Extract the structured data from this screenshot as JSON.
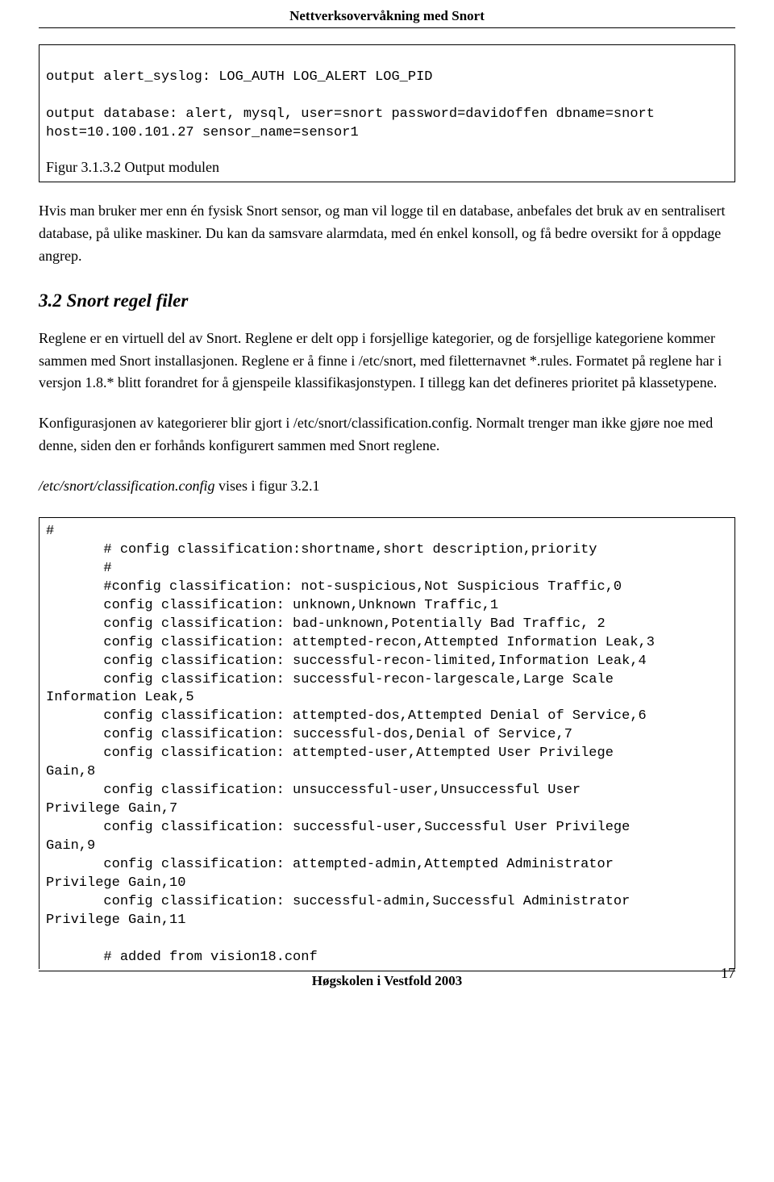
{
  "header": {
    "title": "Nettverksovervåkning med Snort"
  },
  "codebox1": {
    "line1": "output alert_syslog: LOG_AUTH LOG_ALERT LOG_PID",
    "blank": "",
    "line2": "output database: alert, mysql, user=snort password=davidoffen dbname=snort",
    "line3": "host=10.100.101.27 sensor_name=sensor1",
    "caption": "Figur 3.1.3.2 Output modulen"
  },
  "para1": "Hvis man bruker mer enn én fysisk Snort sensor, og man vil logge til en database, anbefales det bruk av en sentralisert database, på ulike maskiner. Du kan da samsvare alarmdata, med én enkel konsoll, og få bedre oversikt for å oppdage angrep.",
  "h2": "3.2 Snort regel filer",
  "para2": "Reglene er en virtuell del av Snort. Reglene er delt opp i forsjellige kategorier, og de forsjellige kategoriene kommer sammen med Snort installasjonen. Reglene er å finne i /etc/snort, med filetternavnet *.rules. Formatet på reglene har i versjon 1.8.* blitt forandret for å gjenspeile klassifikasjonstypen. I tillegg kan det defineres prioritet på klassetypene.",
  "para3": "Konfigurasjonen av kategorierer blir gjort i /etc/snort/classification.config. Normalt trenger man ikke gjøre noe med denne, siden den er forhånds konfigurert sammen med Snort reglene.",
  "para4_a": "/etc/snort/classification.config",
  "para4_b": " vises i figur 3.2.1",
  "codebox2": "#\n       # config classification:shortname,short description,priority\n       #\n       #config classification: not-suspicious,Not Suspicious Traffic,0\n       config classification: unknown,Unknown Traffic,1\n       config classification: bad-unknown,Potentially Bad Traffic, 2\n       config classification: attempted-recon,Attempted Information Leak,3\n       config classification: successful-recon-limited,Information Leak,4\n       config classification: successful-recon-largescale,Large Scale\nInformation Leak,5\n       config classification: attempted-dos,Attempted Denial of Service,6\n       config classification: successful-dos,Denial of Service,7\n       config classification: attempted-user,Attempted User Privilege\nGain,8\n       config classification: unsuccessful-user,Unsuccessful User\nPrivilege Gain,7\n       config classification: successful-user,Successful User Privilege\nGain,9\n       config classification: attempted-admin,Attempted Administrator\nPrivilege Gain,10\n       config classification: successful-admin,Successful Administrator\nPrivilege Gain,11\n\n       # added from vision18.conf",
  "footer": {
    "center": "Høgskolen i Vestfold 2003",
    "page": "17"
  }
}
